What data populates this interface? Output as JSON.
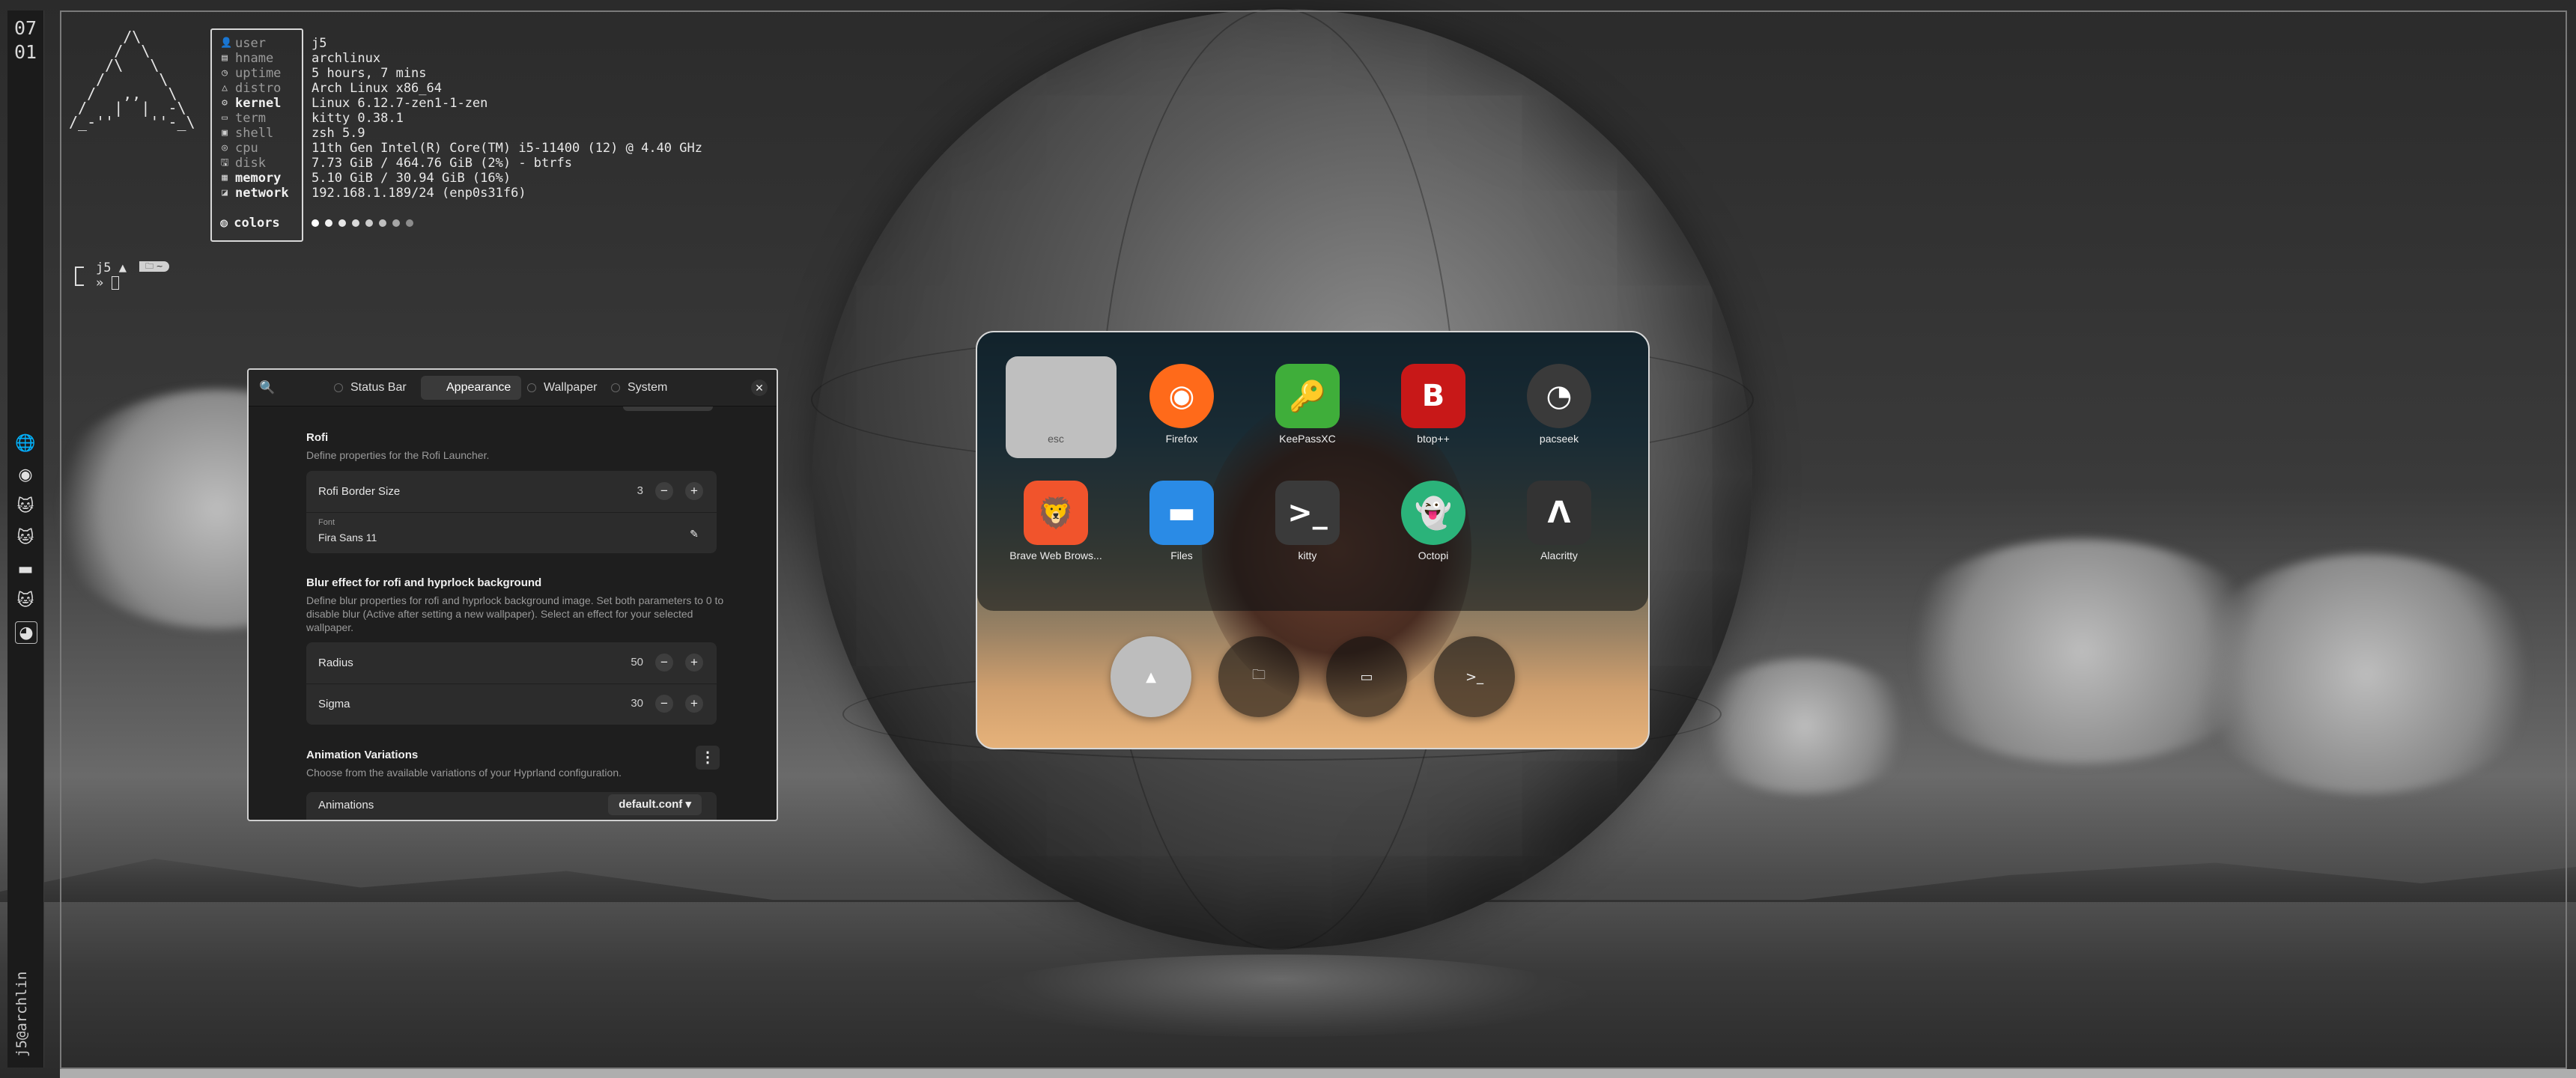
{
  "clock": {
    "hour": "07",
    "minute": "01"
  },
  "bar": {
    "user": "j5@archlin",
    "icons": [
      "globe-icon",
      "firefox-icon",
      "github-cat-icon",
      "github-cat-icon",
      "folder-icon",
      "github-cat-icon",
      "github-icon"
    ]
  },
  "fastfetch": {
    "logo": "      /\\\n     /  \\\n    /\\   \\\n   /      \\\n  /   ,,   \\\n /   |  |  -\\\n/_-''    ''-_\\",
    "keys": [
      {
        "label": "user",
        "icon": "👤",
        "bold": false
      },
      {
        "label": "hname",
        "icon": "▤",
        "bold": false
      },
      {
        "label": "uptime",
        "icon": "◷",
        "bold": false
      },
      {
        "label": "distro",
        "icon": "△",
        "bold": false
      },
      {
        "label": "kernel",
        "icon": "⚙",
        "bold": true
      },
      {
        "label": "term",
        "icon": "▭",
        "bold": false
      },
      {
        "label": "shell",
        "icon": "▣",
        "bold": false
      },
      {
        "label": "cpu",
        "icon": "◎",
        "bold": false
      },
      {
        "label": "disk",
        "icon": "🖫",
        "bold": false
      },
      {
        "label": "memory",
        "icon": "▦",
        "bold": true
      },
      {
        "label": "network",
        "icon": "◪",
        "bold": true
      }
    ],
    "values": [
      "j5",
      "archlinux",
      "5 hours, 7 mins",
      "Arch Linux x86_64",
      "Linux 6.12.7-zen1-1-zen",
      "kitty 0.38.1",
      "zsh 5.9",
      "11th Gen Intel(R) Core(TM) i5-11400 (12) @ 4.40 GHz",
      "7.73 GiB / 464.76 GiB (2%) - btrfs",
      "5.10 GiB / 30.94 GiB (16%)",
      "192.168.1.189/24 (enp0s31f6)"
    ],
    "colors_label": "colors",
    "color_dots": [
      "#ffffff",
      "#f2f2f2",
      "#e6e6e6",
      "#d9d9d9",
      "#cccccc",
      "#bfbfbf",
      "#a6a6a6",
      "#8c8c8c"
    ]
  },
  "prompt": {
    "user": "j5",
    "arrow": "»"
  },
  "settings": {
    "tabs": [
      "Status Bar",
      "Appearance",
      "Wallpaper",
      "System"
    ],
    "active_tab": "Appearance",
    "rofi": {
      "title": "Rofi",
      "desc": "Define properties for the Rofi Launcher.",
      "border_label": "Rofi Border Size",
      "border_value": "3",
      "font_small": "Font",
      "font_value": "Fira Sans 11"
    },
    "blur": {
      "title": "Blur effect for rofi and hyprlock background",
      "desc": "Define blur properties for rofi and hyprlock background image. Set both parameters to 0 to disable blur (Active after setting a new wallpaper). Select an effect for your selected wallpaper.",
      "radius_label": "Radius",
      "radius_value": "50",
      "sigma_label": "Sigma",
      "sigma_value": "30"
    },
    "anim": {
      "title": "Animation Variations",
      "desc": "Choose from the available variations of your Hyprland configuration.",
      "label": "Animations",
      "value": "default.conf"
    }
  },
  "launcher": {
    "apps": [
      {
        "label": "esc",
        "icon": "esc-icon",
        "color": "#bfbfbf",
        "glyph": ""
      },
      {
        "label": "Firefox",
        "icon": "firefox-icon",
        "color": "#ff6a1a",
        "glyph": "◉"
      },
      {
        "label": "KeePassXC",
        "icon": "keepassxc-icon",
        "color": "#3fae3a",
        "glyph": "🔑"
      },
      {
        "label": "btop++",
        "icon": "btop-icon",
        "color": "#c81818",
        "glyph": "B"
      },
      {
        "label": "pacseek",
        "icon": "pacseek-icon",
        "color": "#3a3a3a",
        "glyph": "◔"
      },
      {
        "label": "Brave Web Brows...",
        "icon": "brave-icon",
        "color": "#f1542c",
        "glyph": "🦁"
      },
      {
        "label": "Files",
        "icon": "files-icon",
        "color": "#2a8be6",
        "glyph": "▬"
      },
      {
        "label": "kitty",
        "icon": "kitty-icon",
        "color": "#3a3a3a",
        "glyph": ">_"
      },
      {
        "label": "Octopi",
        "icon": "octopi-icon",
        "color": "#2bb37a",
        "glyph": "👻"
      },
      {
        "label": "Alacritty",
        "icon": "alacritty-icon",
        "color": "#333333",
        "glyph": "Λ"
      }
    ],
    "dock": [
      {
        "name": "dock-arch-icon",
        "glyph": "▲"
      },
      {
        "name": "dock-folder-icon",
        "glyph": "🗀"
      },
      {
        "name": "dock-window-icon",
        "glyph": "▭"
      },
      {
        "name": "dock-terminal-icon",
        "glyph": ">_"
      }
    ]
  }
}
